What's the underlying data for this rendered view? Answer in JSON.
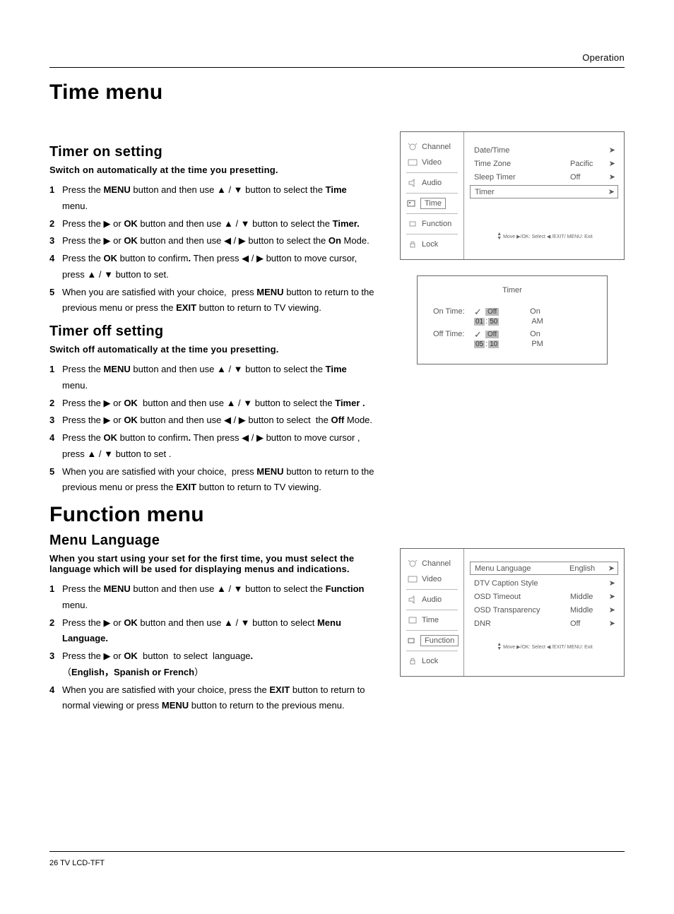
{
  "header_label": "Operation",
  "h1_time": "Time menu",
  "h1_function": "Function menu",
  "timer_on": {
    "heading": "Timer on setting",
    "intro": "Switch on automatically at the time you presetting.",
    "steps": [
      "Press the <b>MENU</b> button and then use ▲ / ▼ button to select the <b>Time</b> menu.",
      "Press the ▶ or <b>OK</b> button and then use ▲ / ▼ button to select the <b>Timer.</b>",
      "Press the ▶ or <b>OK</b> button and then use ◀ / ▶ button to select the <b>On</b> Mode.",
      "Press the <b>OK</b> button to confirm<b>.</b> Then press ◀ / ▶ button to move cursor, press ▲ / ▼ button to set.",
      "When you are satisfied with your choice,&nbsp; press <b>MENU</b> button to return to the previous menu or press the <b>EXIT</b> button to return to TV viewing."
    ]
  },
  "timer_off": {
    "heading": "Timer off setting",
    "intro": "Switch off automatically at the time you presetting.",
    "steps": [
      "Press the <b>MENU</b> button and then use ▲ / ▼ button to select the <b>Time</b> menu.",
      "Press the ▶ or <b>OK</b>&nbsp; button and then use ▲ / ▼ button to select the <b>Timer .</b>",
      "Press the ▶ or <b>OK</b> button and then use ◀ / ▶ button to select &nbsp;the <b>Off</b> Mode.",
      "Press the <b>OK</b> button to confirm<b>.</b> Then press ◀ / ▶ button to move cursor , press ▲ / ▼ button to set .",
      "When you are satisfied with your choice,&nbsp; press <b>MENU</b> button to return to the previous menu or press the <b>EXIT</b> button to return to TV viewing."
    ]
  },
  "menu_lang": {
    "heading": "Menu Language",
    "intro": "When you start using your set for the first time, you must select the language which will be used for displaying menus and indications.",
    "steps": [
      "Press the <b>MENU</b> button and then use ▲ / ▼ button to select the <b>Function</b> menu.",
      "Press the ▶ or <b>OK</b> button and then use ▲ / ▼ button to select <b>Menu Language.</b>",
      "Press the ▶ or <b>OK</b>&nbsp; button&nbsp; to select&nbsp; language<b>.</b><br>（<b>English，Spanish or French</b>）",
      "When you are satisfied with your choice, press the <b>EXIT</b> button to return to normal viewing or press <b>MENU</b> button to return to the previous menu."
    ]
  },
  "osd_cats": {
    "channel": "Channel",
    "video": "Video",
    "audio": "Audio",
    "time": "Time",
    "function": "Function",
    "lock": "Lock"
  },
  "osd_time_rows": [
    {
      "label": "Date/Time",
      "val": "",
      "arrow": "➤"
    },
    {
      "label": "Time Zone",
      "val": "Pacific",
      "arrow": "➤"
    },
    {
      "label": "Sleep Timer",
      "val": "Off",
      "arrow": "➤"
    },
    {
      "label": "Timer",
      "val": "",
      "arrow": "➤",
      "selected": true
    }
  ],
  "osd_hint": "Move ▶/OK: Select ◀ /EXIT/ MENU: Exit",
  "timer_panel": {
    "title": "Timer",
    "on_label": "On Time:",
    "off_label": "Off Time:",
    "off_chip": "Off",
    "on_val": "On",
    "on_time_h": "01",
    "on_time_m": "50",
    "on_ampm": "AM",
    "off_time_h": "05",
    "off_time_m": "10",
    "off_ampm": "PM"
  },
  "osd_func_rows": [
    {
      "label": "Menu Language",
      "val": "English",
      "arrow": "➤",
      "selected": true
    },
    {
      "label": "DTV Caption Style",
      "val": "",
      "arrow": "➤"
    },
    {
      "label": "OSD Timeout",
      "val": "Middle",
      "arrow": "➤"
    },
    {
      "label": "OSD Transparency",
      "val": "Middle",
      "arrow": "➤"
    },
    {
      "label": "DNR",
      "val": "Off",
      "arrow": "➤"
    }
  ],
  "footer": "26  TV LCD-TFT"
}
